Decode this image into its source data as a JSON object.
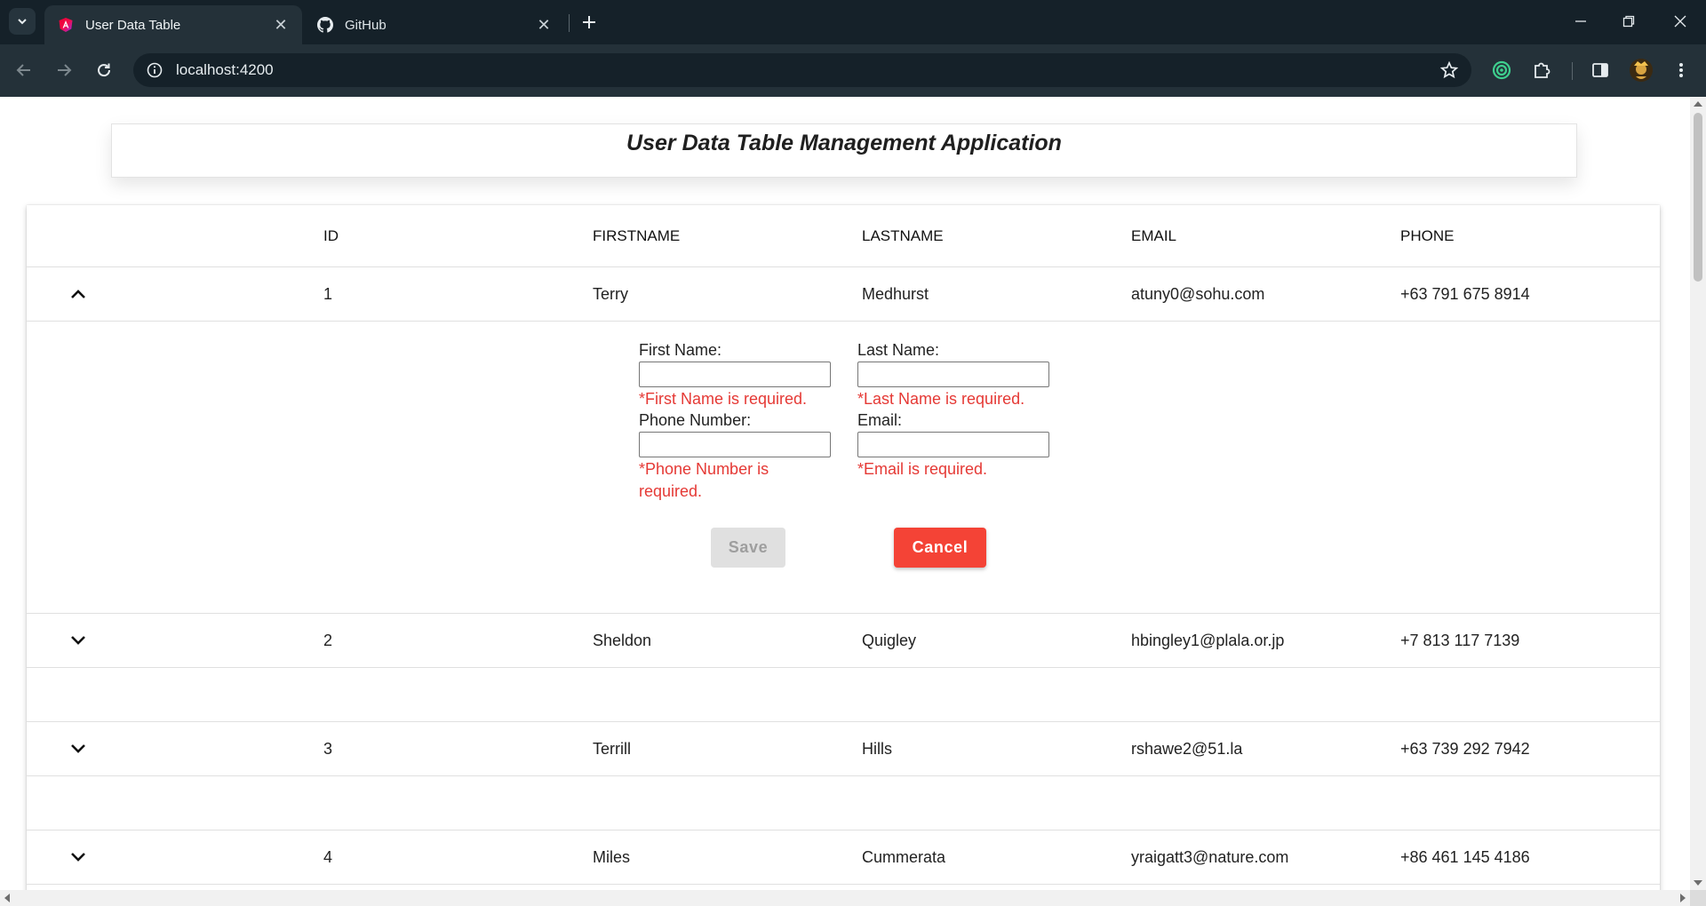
{
  "browser": {
    "tabs": [
      {
        "title": "User Data Table",
        "active": true,
        "icon": "angular-icon"
      },
      {
        "title": "GitHub",
        "active": false,
        "icon": "github-icon"
      }
    ],
    "url": "localhost:4200",
    "accent_color": "#152129"
  },
  "app": {
    "title": "User Data Table Management Application"
  },
  "table": {
    "columns": [
      "ID",
      "FIRSTNAME",
      "LASTNAME",
      "EMAIL",
      "PHONE"
    ],
    "rows": [
      {
        "id": "1",
        "firstname": "Terry",
        "lastname": "Medhurst",
        "email": "atuny0@sohu.com",
        "phone": "+63 791 675 8914",
        "expanded": true,
        "chevron": "chevron-up-icon"
      },
      {
        "id": "2",
        "firstname": "Sheldon",
        "lastname": "Quigley",
        "email": "hbingley1@plala.or.jp",
        "phone": "+7 813 117 7139",
        "expanded": false,
        "chevron": "chevron-down-icon"
      },
      {
        "id": "3",
        "firstname": "Terrill",
        "lastname": "Hills",
        "email": "rshawe2@51.la",
        "phone": "+63 739 292 7942",
        "expanded": false,
        "chevron": "chevron-down-icon"
      },
      {
        "id": "4",
        "firstname": "Miles",
        "lastname": "Cummerata",
        "email": "yraigatt3@nature.com",
        "phone": "+86 461 145 4186",
        "expanded": false,
        "chevron": "chevron-down-icon"
      }
    ]
  },
  "edit_form": {
    "first_name_label": "First Name:",
    "first_name_value": "",
    "first_name_error": "*First Name is required.",
    "last_name_label": "Last Name:",
    "last_name_value": "",
    "last_name_error": "*Last Name is required.",
    "phone_label": "Phone Number:",
    "phone_value": "",
    "phone_error_line1": "*Phone Number is",
    "phone_error_line2": "required.",
    "email_label": "Email:",
    "email_value": "",
    "email_error": "*Email is required.",
    "save_label": "Save",
    "save_disabled": true,
    "cancel_label": "Cancel",
    "error_color": "#e53935",
    "cancel_color": "#f44336"
  }
}
